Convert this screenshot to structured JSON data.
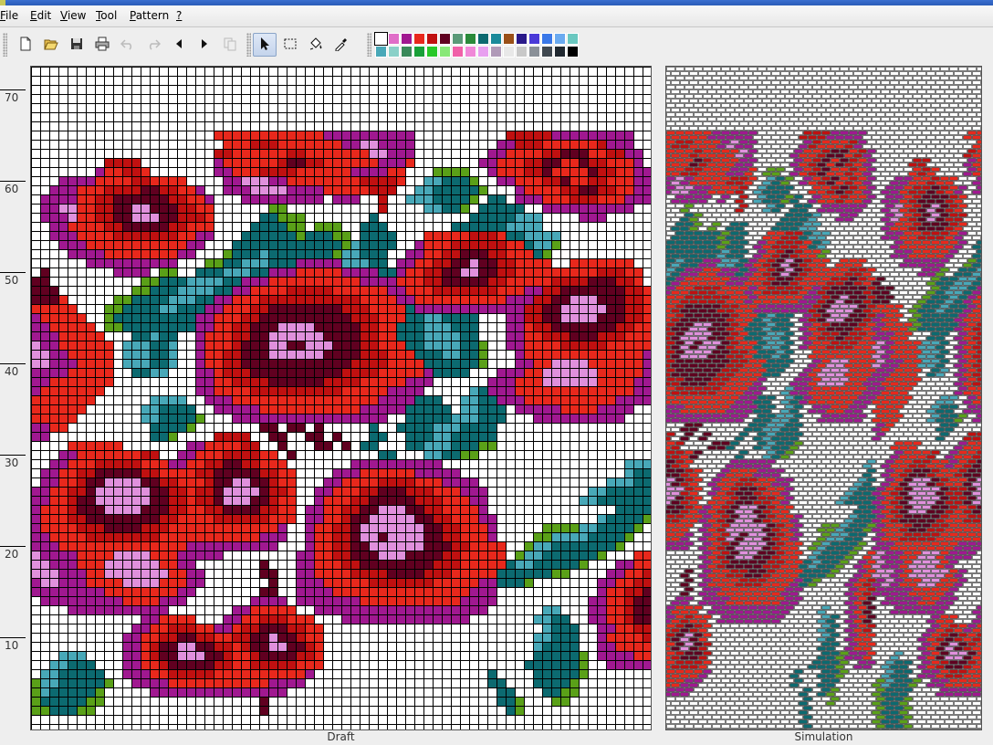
{
  "window": {
    "title_visible": ""
  },
  "menu": [
    {
      "label": "File",
      "mnemonic": "F"
    },
    {
      "label": "Edit",
      "mnemonic": "E"
    },
    {
      "label": "View",
      "mnemonic": "V"
    },
    {
      "label": "Tool",
      "mnemonic": "T"
    },
    {
      "label": "Pattern",
      "mnemonic": "P"
    },
    {
      "label": "?",
      "mnemonic": "?"
    }
  ],
  "toolbar": [
    {
      "id": "new",
      "icon": "new-file-icon",
      "enabled": true
    },
    {
      "id": "open",
      "icon": "open-folder-icon",
      "enabled": true
    },
    {
      "id": "save",
      "icon": "save-disk-icon",
      "enabled": true
    },
    {
      "id": "print",
      "icon": "printer-icon",
      "enabled": true
    },
    {
      "id": "undo",
      "icon": "undo-icon",
      "enabled": false
    },
    {
      "id": "redo",
      "icon": "redo-icon",
      "enabled": false
    },
    {
      "id": "shift-left",
      "icon": "arrow-left-icon",
      "enabled": true
    },
    {
      "id": "shift-right",
      "icon": "arrow-right-icon",
      "enabled": true
    },
    {
      "id": "copy",
      "icon": "copy-icon",
      "enabled": false
    },
    {
      "id": "pointer",
      "icon": "pointer-arrow-icon",
      "enabled": true,
      "pressed": true
    },
    {
      "id": "select",
      "icon": "rect-select-icon",
      "enabled": true
    },
    {
      "id": "fill",
      "icon": "paint-bucket-icon",
      "enabled": true
    },
    {
      "id": "pick",
      "icon": "eyedropper-icon",
      "enabled": true
    }
  ],
  "palette": {
    "selected": 0,
    "row1": [
      "#ffffff",
      "#e06ec8",
      "#a01890",
      "#e8281c",
      "#c01010",
      "#600020",
      "#5a9a78",
      "#2a8a3a",
      "#0c6a70",
      "#1a8a9a",
      "#9a5018",
      "#2a1a8a",
      "#4a3ad8",
      "#3a78e8",
      "#6aaaf0",
      "#6ac8c0"
    ],
    "row2": [
      "#48a8b8",
      "#8ad0c8",
      "#3a8a5a",
      "#18a038",
      "#28c828",
      "#88e878",
      "#f060a8",
      "#f088d8",
      "#e8a0f0",
      "#b09ab8",
      "#e8e8e8",
      "#c8c8c8",
      "#8a9098",
      "#404850",
      "#202830",
      "#000000"
    ]
  },
  "ruler": {
    "labels": [
      "70",
      "60",
      "50",
      "40",
      "30",
      "20",
      "10"
    ]
  },
  "panes": {
    "draft_label": "Draft",
    "simulation_label": "Simulation"
  },
  "pattern": {
    "legend": {
      ".": "#ffffff",
      "R": "#e8281c",
      "D": "#c01010",
      "K": "#600020",
      "P": "#a01890",
      "L": "#e090dc",
      "T": "#0c6a70",
      "C": "#48a8b8",
      "G": "#5aa018"
    },
    "rows": [
      "....................................................................",
      "....................................................................",
      "....................................................................",
      "....................................................................",
      "....................................................................",
      "....................................................................",
      "....................................................................",
      "....................RRRRRRRRRRRRPPPPPPPPPP..........DDDDDPPPPPPPPP..",
      ".....................RRRDDDRRRRRRRPPLLPPPP.........PPDDDRRRRRRDPPP..",
      "....................DDRRRRRRDDRRRRRRRLLPPP........PPRRRRDDKKKRRDDPP.",
      "........DDDD........PRRRRRRDKKDDRRRRRRPPPR.......PPRRRDDKKRRKDDRRRP.",
      ".......PRRDDR.......PPRRRDDDDRRRRRRPPPPRR...GGGG..PRRRDDKRRRRKDDRRPP.",
      "...PPPPRRRRDDRRRR....PPLLLPPRRRRRRRRDDDDR..CCTTTG..PPRRRDDKRRDDRRRPP.",
      "..PPPRRRDDDDKKDDRRP..PPPLLLLPPPPRRRRRDDD..CCTTTTTG...PRRRRDDKKDDRRPP.",
      ".PPPPRRDDKKKKKKDDRRP...PPPPPPPPP.PPP..D..CCCTTTTG.TT.PPPRRRDDDRRRPPP.",
      ".PPLLRRDDKKLLKKKDDRR......GG..........D....CCTTG.TTTTT..PPPPPPPPPP...",
      ".PPPLRRDDKKLLLKKDDDR.....TTGGG.......T..........TTTTTCCC....PPP......",
      "..PPRRRRDDKKKKKDDRRR....TTTTGG.GGG..TTT.......TTTTTTCCCC.............",
      "..PPPRRRRDDDDDDDRRPP...TTTTTTGTTTGG.TTTT...RRRRRDDDRTTCCCC...........",
      "...PPPRRRRRRRRRRRPP...TTTTTTTTTTTTGCTTTT..PRRRDDDDDDRRTCCG...........",
      "....PPPPRRRRRRRRPP...GTTTCTTTTTTTGCCTTT..PPRRDDKKKDDRRRTG............",
      "......PPPPPPPPPP...GGTTCCCTTTPPPPPCCCTT.PPRRDDKKLKKDDRRRR..RRRRRRR...",
      ".K.......PPPP.GG..TTTCCCTTPPPRRRRRPPPPTTPRRDDKKLLKKDDRRRRRRRRRDDDRR..",
      "KK..........GGTTTCCCCTTPPPRRRRRRRRRRPPPPRRRDDKKKKKDDRRRRRDDDDKKKDDR..",
      "KKK........GGTTTCCCCTTPPRRRRDDDDDRRRRRRPPRRRDDDDDDDRRRPPDDKKKKKKKDDR.",
      "KKKR.....GGTTTTCCCTTPPRRRDDDDDDDDDDDRRRRPPRRRRRRRRRRPPPDDKKLLLKKKDDRR",
      "RRRRR...GGTTTTCCTTTPPRRRDDKKKKKKKKDDDRRRRTPPPPPPPPPPPPDDKKLLLLLKKDDRR",
      "PRRRRR..GTTTTTTTTTPPRRRDDKKKKKKKKKKDDDRRRTTCCTTTT...PPDDKKLLLLKKKDDRRR",
      "PPRRRRR.GGTTTTTTTTPPRRDDKKKLLLLKKKKKDDRRTTTCCCTTT...PPRDDKKKKKKKDDRRRP",
      "PPPRRRRR...TTCTT..PRRRDDKKLLLLLLKKKKDDRRTTTCCCCTT...PPRRDDDKKKDDDRRRPP",
      "LPPRRRRRR.CCCTTC..PRRRDKKKLLKKLLLKKKDDRRRTTCCCCTTG..PPRRRRDDDDDRRRRRPP",
      "LLPPRRRRR.CCCTTC..PRRDDKKKLLLLLLKKKKDDDRRRTTTCCTTG...PRRRRRRRRRRRRRPP.",
      "LLPPPRRRR.CCCTTC..PRRDDKKKKKKKKKKKKDDDDRRRRTTTTTTG...PPRRLLLLRRRRRRPP.",
      "PPPPRRRRR..TTCC...PPRDDDKKKKKKKKKKDDDDRRRRRPTTTT...PPPRRLLLLLLRRRRRPP.",
      "PPRRRRRRR.........PPRRDDDDKKKKKKDDDDRRRRRPPP......PPPRRRLLLLLLRRRRPP..",
      "PRRRRRRR..........PPRRRRDDDDDDDDDDRRRRRPPPP.....CTPPPRRRRRRRRRRRRRPP..",
      "RRRRRRR......CCCC..PPPRRRRRRRRRRRRRRRRPPPPTTT..CCTTPPPRRRRRRRRRRPPPP..",
      "RRRRRR......CCTTTT..PPPPPRRRRRRRRRRRPPPPPTTTTT.CCTTT.PPPPPRRRRPPPP....",
      "RRRRR.......CCTTTTG...PPPPPPPPPPPPPPPPP..TTTTTCCCTTT...PPPPPPPPPP.....",
      "PPRR.........TTTTG.......KK.KK.K.....T..TTTTCCCTTTT..................",
      "PP...........TTG....DDDD..KK..KK.K...TT..TTTCCTTTTT..................",
      "....RRRRRR.......PPRRRRDD..K...KK.K.TT...TTCCCTTTGG..................",
      "...PPRRRRRRRDD..PPRRRDDDDRR.K.........TT...CCTTGG....................",
      "..PPRRRDDDDDRRRPPRRDDKKDDRRR.......PPPPPPPPPP....................CCCC",
      ".PPRRDDKKKKKDDRRRRDDKKKKKDDRR....PPPRRRRRRPPPPP..................CTTT",
      ".PPRRDKKLLLLKKDDRRRDKKLLKKDRR...PPRRRRDDDDRRRPPPP..............CCCTTTT",
      "PPRRDDKLLLLLLKKDDRDDKLLLLKDDR..PPRRRDDKKKDDDRRRPPP...........CCTTTTTT",
      "PPRRDKKLLLLLLKKDDRDDKLLLKKDRR..PRRRDDKKKKKDDDRRRPP..........CCTTTTTT.",
      "PRRRDKKKLLLLKKKDDRRDDKKKKDDRR.PPRRDDKKLLLKKDDRRRRP..............TTTTT.",
      "PRRRDDKKKKKKKKDDRRRRDDDDDDRRR.PPRRDKKLLLLLKKDDRRRPP...........CTTTTG..",
      "PRRRRDDDKKKKDDDRRRRRRRRRRRRP..PRRDDKLLLLLLLKKDDRRRP.....GGGGCCTTTTG...",
      "PPRRRRDDDDDDDDRRRRRRRRRRRPPP..PRRDDKLLKLLLLKKDDRRRP....GGCCCCTTTTG....",
      "PPPRRRRRRRRRRRRRRPPPPPPPPPP...PRRDDKKLLLLLLKKKDDRRRR..GCCTTTTTTTG.....",
      "LPPPPRRRRLLLLRRRPPPPP........PPRRDDKKKLLLKKKKDDRRRRR.GCCTTTTTTG...RRRR",
      "LLPPPRRRLLLLLLRRPP.......K...PPRRRDDKKKKKKKKDDDRRRRRTCCTTTTTG...PPRRRD",
      "LLLPPPRRLLLLLLLRRPP......KK..PPRRRRDDDDKKKKDDDRRRRRTTTTTTGG....PPRRDDD",
      "PLLPPPRRRRLLLLRRRPP.......K..PPPRRRRRDDDDDDDRRRRRPPTTTG.......PPRRDDKK",
      "PPPPPPPPRRRRRRRRPP.......KK..PPPPRRRRRRRRRRRRRRRPPP...........PRRDDKKL",
      ".PPPPPPPPPRRRRPPP.......PPPP.PPPPPPPRRRRRRRRRRRPPPP..........PPRRDKKLL",
      "....PPPPPPPPPPP.......PPRRRRR..PPPPPPPPPPPPPPPPPPP......CC...PPRRDKKLL",
      "............PPRRRR...PPRRDDDRRR...PPPPPPPPPPPPPP.......CCTT..PPRRDKKKL",
      "...........PPRRDDDRRPPRDDKKKDDRR........................CTTT..PPRRDDKKK",
      "..........PPRRDDKKDDRRDDKKLKKDRR.......................CCTTT..PRRRRDDDD",
      "..........PPRDKKLLKKDDRDKKLLKKDR.......................CTTTT..PPRRRRRRR",
      "...CCC....PPRDKKLLLKKDRRDKKKKDDR.......................TTTTTG.PPPPRRRRR",
      "..CCTTT...PPRRDKKKKKDDRRDDDDDRRR......................TTTTTTG..PPPPPPP.",
      ".CCTTTTT..PPPRRDDDDDRRRRRRRRRRP...................T....TTTTTG.........",
      "GCCTTTTTG..PPPPRRRRRRRRRRRPPPP....................TT...TTTTG..........",
      "GCTTTTTG.....PPPPPPPPPPPPPPP.......................TT...TTGG..........",
      "GTTTTTGG.................K.........................TTG...GG...........",
      "GGTTTGG..................K..........................TG................"
    ]
  }
}
